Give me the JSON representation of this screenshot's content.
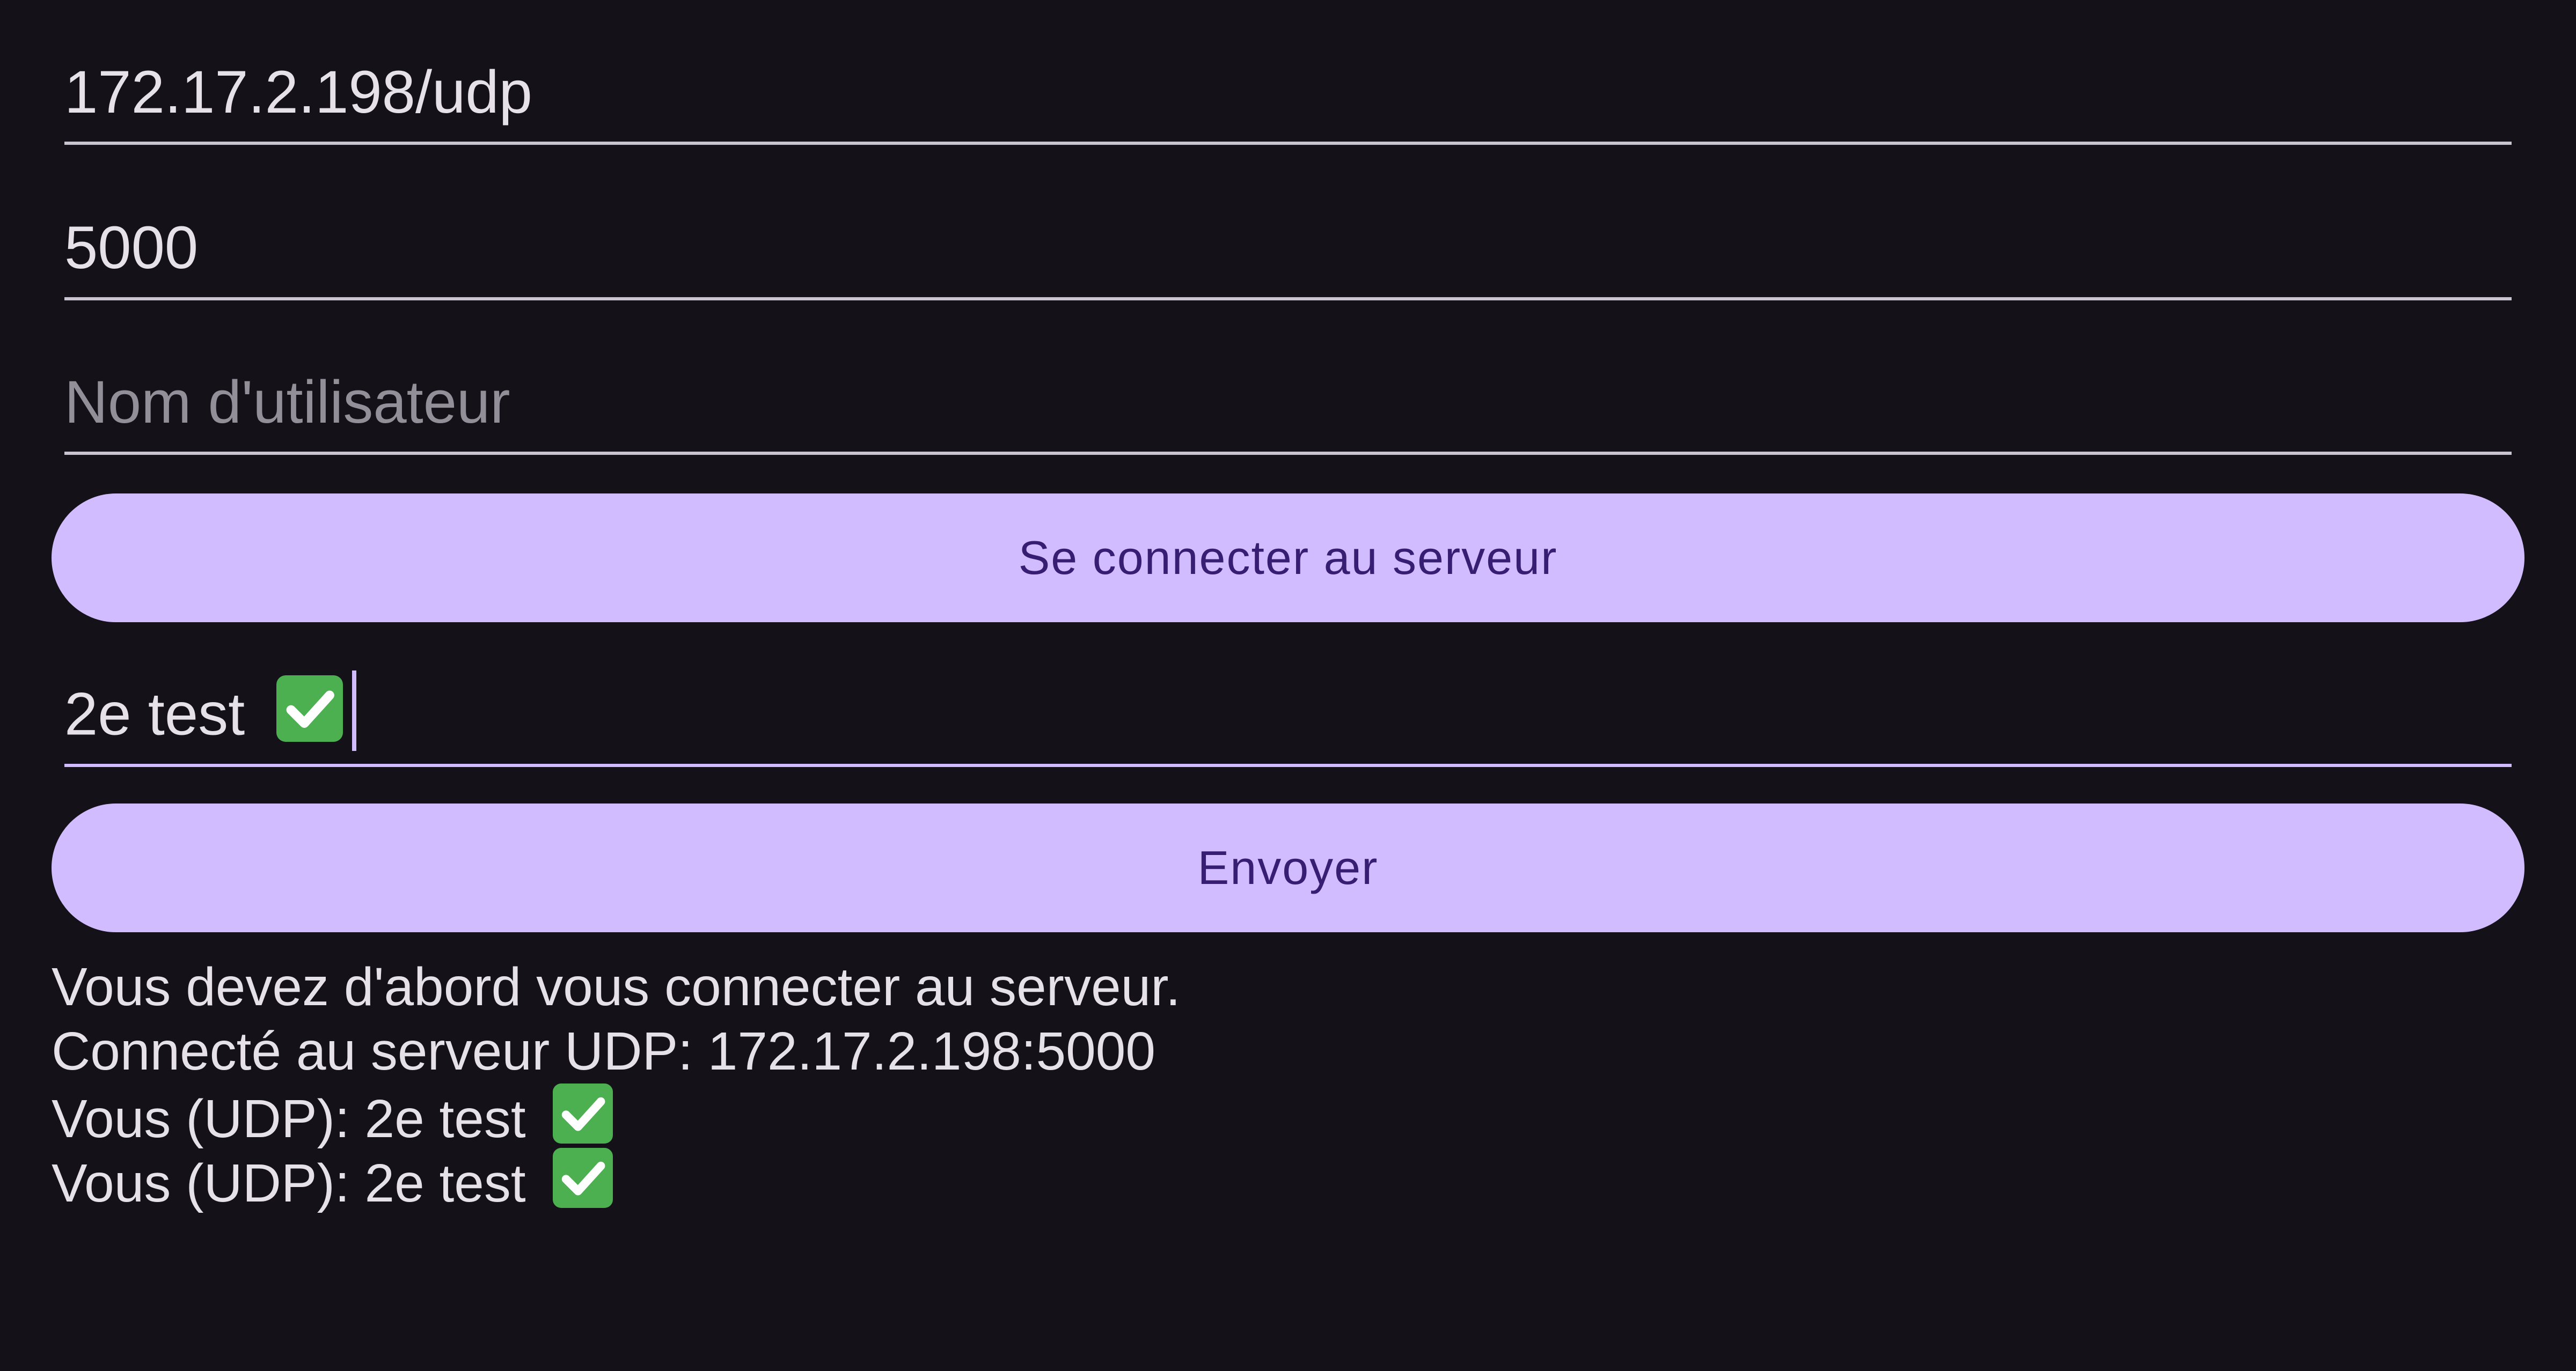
{
  "form": {
    "address_value": "172.17.2.198/udp",
    "port_value": "5000",
    "username_placeholder": "Nom d'utilisateur",
    "username_value": "",
    "connect_label": "Se connecter au serveur",
    "message_value": "2e test",
    "message_emoji": "check-mark-emoji",
    "send_label": "Envoyer"
  },
  "log": {
    "lines": [
      {
        "text": "Vous devez d'abord vous connecter au serveur.",
        "emoji": ""
      },
      {
        "text": "Connecté au serveur UDP: 172.17.2.198:5000",
        "emoji": ""
      },
      {
        "text": "Vous (UDP): 2e test",
        "emoji": "check-mark-emoji"
      },
      {
        "text": "Vous (UDP): 2e test",
        "emoji": "check-mark-emoji"
      }
    ]
  },
  "colors": {
    "background": "#141218",
    "button": "#d0bcff",
    "button_text": "#381e72",
    "text": "#e6e0e9",
    "placeholder": "#938f99",
    "underline": "#cac4d0",
    "check_green": "#4caf50"
  }
}
